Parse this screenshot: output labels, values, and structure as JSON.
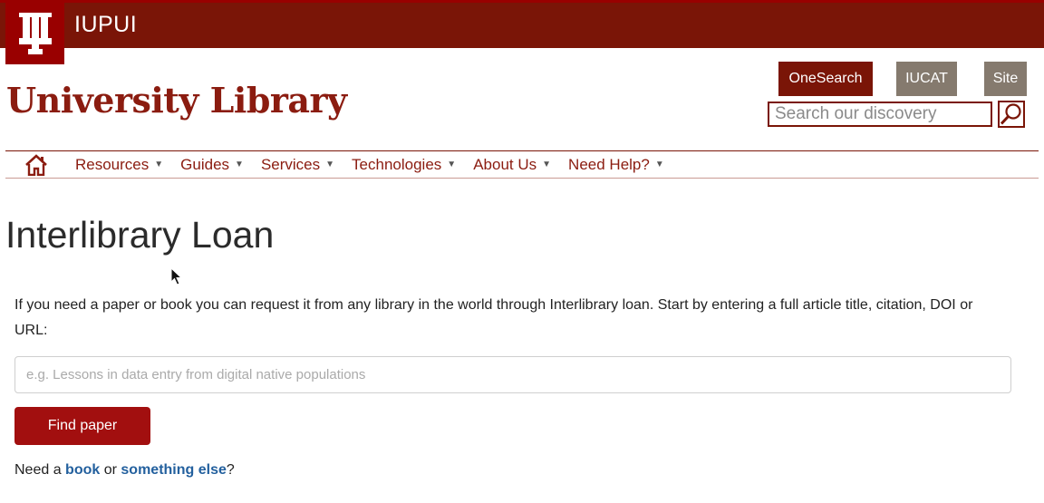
{
  "header": {
    "brand": "IUPUI",
    "library_title": "University Library",
    "search_scopes": [
      "OneSearch",
      "IUCAT",
      "Site"
    ],
    "search_placeholder": "Search our discovery"
  },
  "nav": {
    "items": [
      {
        "label": "Resources"
      },
      {
        "label": "Guides"
      },
      {
        "label": "Services"
      },
      {
        "label": "Technologies"
      },
      {
        "label": "About Us"
      },
      {
        "label": "Need Help?"
      }
    ]
  },
  "main": {
    "title": "Interlibrary Loan",
    "intro": "If you need a paper or book you can request it from any library in the world through Interlibrary loan. Start by entering a full article title, citation, DOI or URL:",
    "input_placeholder": "e.g. Lessons in data entry from digital native populations",
    "find_button": "Find paper",
    "need_prefix": "Need a",
    "book_link": "book",
    "or_text": "or",
    "else_link": "something else",
    "need_suffix": "?"
  },
  "colors": {
    "crimson": "#990000",
    "dark_crimson": "#7a1507",
    "taupe": "#857a6e",
    "link_blue": "#23609e"
  }
}
